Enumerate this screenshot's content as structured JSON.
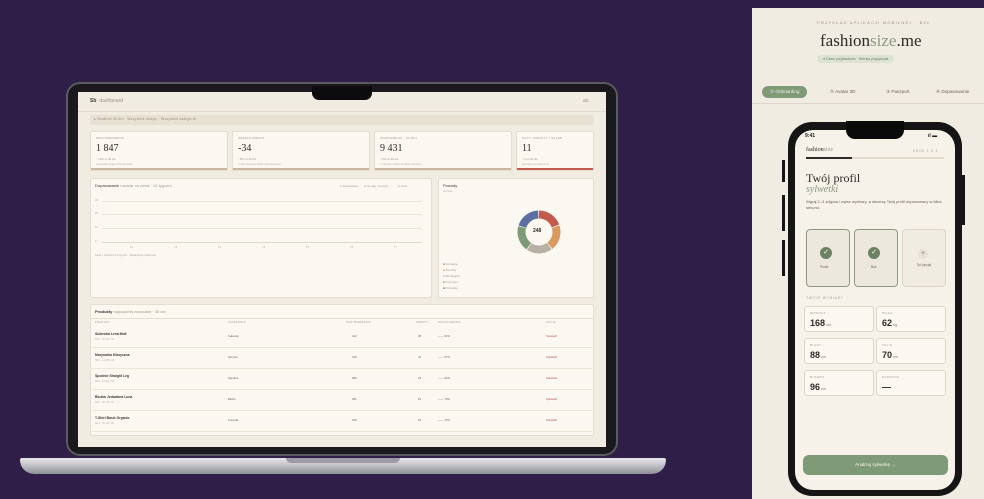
{
  "laptop": {
    "brand": "Sb",
    "brand_sub": "dashboard",
    "top_right": "Sb",
    "filter_text": "▸ Ostatnie 30 dni   ·   Wszystkie sklepy   ·   Wszystkie kategorie",
    "kpis": [
      {
        "label": "PRZYMIERZENIA",
        "value": "1 847",
        "sub1": "↑ 12% vs 30 dni",
        "sub2": "wszystkie sesje przymierzalni",
        "accent": "#c9b89d"
      },
      {
        "label": "ŚREDNI ZWROT",
        "value": "-34",
        "sub1": "↓ 8% vs 30 dni",
        "sub2": "mniej zwrotów dzięki dopasowaniu",
        "accent": "#c9b89d"
      },
      {
        "label": "ZAMÓWIENIA · 30 DNI",
        "value": "9 431",
        "sub1": "↑ 5% vs 30 dni",
        "sub2": "z użyciem rekomendacji rozmiaru",
        "accent": "#c9b89d"
      },
      {
        "label": "KRYT. ZWROTY / SKLEP",
        "value": "11",
        "sub1": "↑ 3 vs 30 dni",
        "sub2": "wymaga sprawdzenia",
        "accent": "#c25a4e"
      }
    ],
    "chart_panel": {
      "title": "Dopasowanie",
      "title_sub": "rozmiar vs zwrot · 12 tygodni",
      "legend": [
        "● dopasowany",
        "● za mały / za duży",
        "● zwrot"
      ],
      "y_ticks": [
        "40",
        "20",
        "10",
        "0"
      ],
      "x_ticks": [
        "T1",
        "T2",
        "T3",
        "T4",
        "T5",
        "T6",
        "T7"
      ],
      "footnote": "Dane z ostatnich 12 tygodni · aktualizacja codziennie"
    },
    "donut_panel": {
      "title": "Powody",
      "subtitle": "zwrotów",
      "center": "248",
      "legend": [
        "Za ciasne",
        "Za luźne",
        "Zła długość",
        "Inny fason",
        "Pozostałe"
      ],
      "colors": [
        "#c25a4e",
        "#d99a60",
        "#b8b0a3",
        "#7f9a77",
        "#5a6fa0"
      ]
    },
    "table": {
      "title": "Produkty",
      "title_sub": "najczęściej zwracane · 30 dni",
      "headers": [
        "PRODUKT",
        "KATEGORIA",
        "PRZYMIERZENIA",
        "ZWROTY",
        "DOPASOWANIE",
        "AKCJA"
      ],
      "rows": [
        {
          "name": "Sukienka Lena Midi",
          "sub": "SKU · 18 222 / 01",
          "cat": "Sukienki",
          "tries": "412",
          "ret": "38",
          "fit": "—— 61%",
          "action": "Sprawdź"
        },
        {
          "name": "Marynarka Klasyczna",
          "sub": "SKU · 14 405 / 03",
          "cat": "Okrycia",
          "tries": "318",
          "ret": "31",
          "fit": "—— 57%",
          "action": "Sprawdź"
        },
        {
          "name": "Spodnie Straight Leg",
          "sub": "SKU · 21 019 / 02",
          "cat": "Spodnie",
          "tries": "286",
          "ret": "24",
          "fit": "—— 64%",
          "action": "Sprawdź"
        },
        {
          "name": "Bluzka Jedwabna Luna",
          "sub": "SKU · 09 774 / 01",
          "cat": "Bluzki",
          "tries": "251",
          "ret": "19",
          "fit": "—— 70%",
          "action": "Sprawdź"
        },
        {
          "name": "T-Shirt Basic Organic",
          "sub": "SKU · 30 112 / 05",
          "cat": "Koszulki",
          "tries": "198",
          "ret": "16",
          "fit": "—— 73%",
          "action": "Sprawdź"
        }
      ]
    }
  },
  "panel": {
    "kicker": "PRZYKŁAD APLIKACJI MOBILNEJ · B2C",
    "logo_a": "fashion",
    "logo_b": "size",
    "logo_c": ".me",
    "pill": "● Dane przykładowe · Wersja poglądowa",
    "tabs": [
      "① Onboarding",
      "② Avatar 3D",
      "③ Paszport",
      "④ Dopasowanie"
    ],
    "phone": {
      "time": "9:41",
      "status_icons": "ıl ▬",
      "logo_a": "fashion",
      "logo_b": "size",
      "step": "KROK 1 Z 3",
      "title": "Twój profil",
      "title2": "sylwetki",
      "desc": "Wgraj 2–3 zdjęcia i wpisz wymiary, a stworzę Twój profil dopasowany w kilka sekund.",
      "photos": [
        {
          "label": "Przód",
          "state": "done"
        },
        {
          "label": "Bok",
          "state": "done"
        },
        {
          "label": "Tył (opcja)",
          "state": "empty"
        }
      ],
      "section": "TWOJE WYMIARY",
      "measures": [
        {
          "label": "WZROST",
          "value": "168",
          "unit": "cm"
        },
        {
          "label": "WAGA",
          "value": "62",
          "unit": "kg"
        },
        {
          "label": "BIUST",
          "value": "88",
          "unit": "cm"
        },
        {
          "label": "TALIA",
          "value": "70",
          "unit": "cm"
        },
        {
          "label": "BIODRA",
          "value": "96",
          "unit": "cm"
        },
        {
          "label": "RAMIONA",
          "value": "—",
          "unit": ""
        }
      ],
      "cta": "Analizuj sylwetkę →"
    }
  },
  "colors": {
    "background": "#2e1e48",
    "accent_green": "#7f9a77",
    "accent_red": "#c25a4e",
    "panel_bg": "#f1ece2"
  }
}
